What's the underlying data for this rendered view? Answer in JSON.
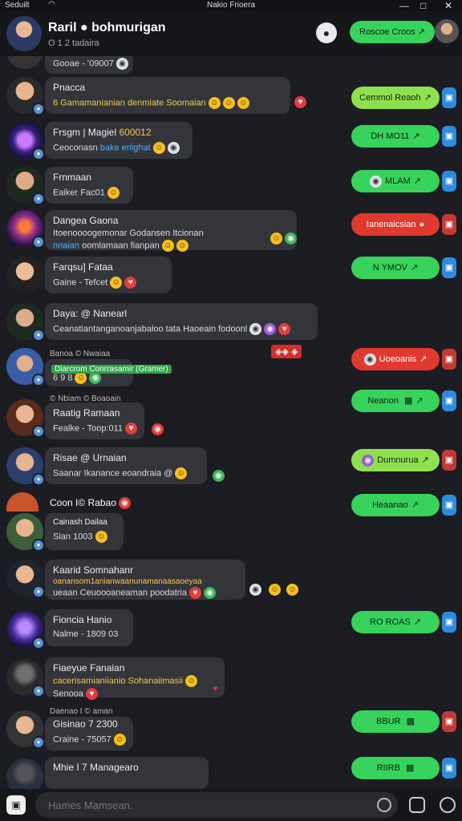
{
  "statusbar": {
    "carrier": "Seduilt",
    "title": "Nakio Frioera"
  },
  "header": {
    "name": "Raril ● bohmurigan",
    "sub": "O 1 2 tadaira",
    "action_pill": "Roscoe Croos ↗"
  },
  "rows": [
    {
      "msg": "Gooae - ʻ09007"
    },
    {
      "name": "Pnacca",
      "msg": "6 Gamamanianian denmiate Soomaian",
      "side": "Cemmol Reaoh"
    },
    {
      "name": "Frsgm | Magiel",
      "name_hl": "600012",
      "msg": "Ceoconasn",
      "msg_bl": "bake eriighat",
      "side": "DH MO11"
    },
    {
      "name": "Frnmaan",
      "msg": "Eaiker Fac01",
      "side": "MLAM"
    },
    {
      "name": "Dangea Gaona",
      "msg": "Itoenoooogemonar Godansen Itcionan",
      "msg2_bl": "nnaian",
      "msg2": "oomlamaan fianpan",
      "side": "Ianenaicsian"
    },
    {
      "name": "Farqsu] Fataa",
      "msg": "Gaine - Tefcet",
      "side": "N YMOV"
    },
    {
      "name": "Daya: @ Nanearl",
      "msg": "Ceanatiantanganoanjabaloo tata Haoeain fodoonl",
      "tag": "◈◈ ◈"
    },
    {
      "top": "Banoa © Nwaiaa",
      "green": "Diarcrom Conrrasamir (Gramer)",
      "msg": "6 9 8",
      "side": "Uoeoanis"
    },
    {
      "top": "© Nbiam © Boaoain",
      "name": "Raatig Ramaan",
      "msg": "Fealke - Toop:011",
      "side": "Neanon"
    },
    {
      "name": "Risae @ Urnaian",
      "msg": "Saanar Ikanance eoandraia @",
      "side": "Dumnurua"
    },
    {
      "name": "Coon I© Rabao",
      "side": "Heaanao"
    },
    {
      "name": "Cainash Dailaa",
      "msg": "Sian 1003"
    },
    {
      "name": "Kaarid Somnahanr",
      "name_hl": "oanansom1anianwaanunamanaasaoeyaa",
      "msg": "ueaan Ceuoooaneaman poodatria"
    },
    {
      "name": "Fioncia Hanio",
      "msg": "Nalme - 1809 03",
      "side": "RO ROAS"
    },
    {
      "name": "Fiaeyue Fanaian",
      "msg_hl": "cacerisamianiianio Sohanaiimasii",
      "msg": "Senooa",
      "side": ""
    },
    {
      "top": "Daenao I © aman",
      "name": "Gisinao 7 2300",
      "msg": "Craine - 75057",
      "side": "BBUR"
    },
    {
      "name": "Mhie I 7 Managearo",
      "side": "RIIRB"
    }
  ],
  "composer": {
    "placeholder": "Hames Mamsean."
  },
  "colors": {
    "accent": "#37d35d",
    "danger": "#e0392f",
    "bubble": "#34353b",
    "bg": "#1c1d22"
  }
}
